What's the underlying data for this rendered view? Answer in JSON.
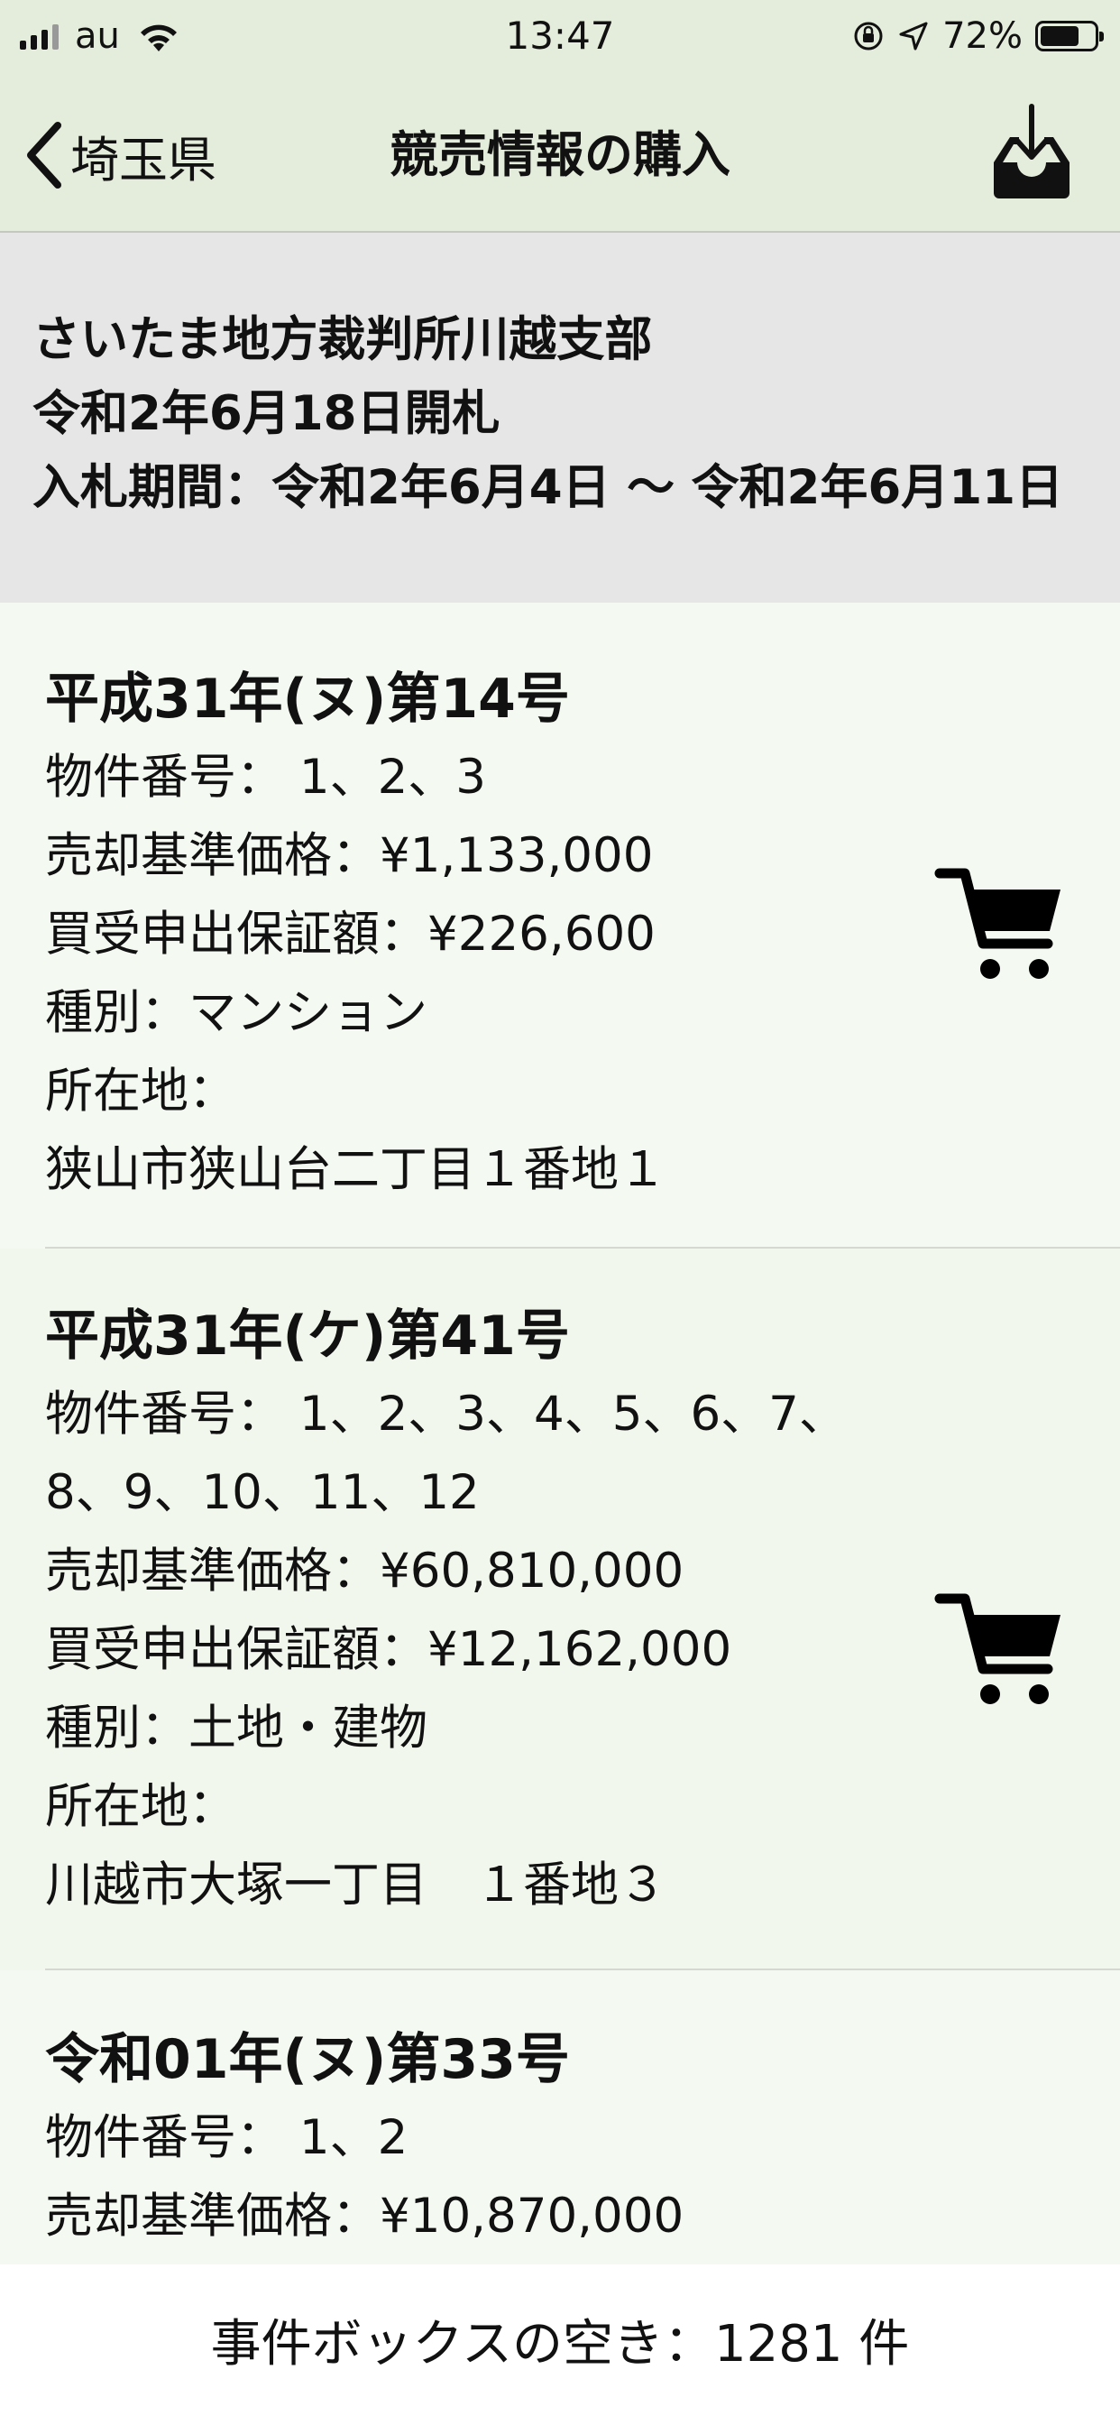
{
  "status_bar": {
    "carrier": "au",
    "time": "13:47",
    "battery_percent": "72%",
    "battery_level": 0.72
  },
  "nav": {
    "back_label": "埼玉県",
    "title": "競売情報の購入",
    "download_icon": "download-tray-icon"
  },
  "auction": {
    "court": "さいたま地方裁判所川越支部",
    "opening": "令和2年6月18日開札",
    "period": "入札期間：令和2年6月4日 〜 令和2年6月11日"
  },
  "cases": [
    {
      "title": "平成31年(ヌ)第14号",
      "property_numbers": "物件番号： 1、2、3",
      "property_numbers_cont": "",
      "base_price": "売却基準価格：¥1,133,000",
      "deposit": "買受申出保証額：¥226,600",
      "type": "種別：マンション",
      "location_label": "所在地：",
      "location": "狭山市狭山台二丁目１番地１"
    },
    {
      "title": "平成31年(ケ)第41号",
      "property_numbers": "物件番号： 1、2、3、4、5、6、7、",
      "property_numbers_cont": "8、9、10、11、12",
      "base_price": "売却基準価格：¥60,810,000",
      "deposit": "買受申出保証額：¥12,162,000",
      "type": "種別：土地・建物",
      "location_label": "所在地：",
      "location": "川越市大塚一丁目　１番地３"
    },
    {
      "title": "令和01年(ヌ)第33号",
      "property_numbers": "物件番号： 1、2",
      "base_price": "売却基準価格：¥10,870,000"
    }
  ],
  "footer": {
    "box_free": "事件ボックスの空き：1281 件"
  },
  "colors": {
    "bar_background": "#e4ecdb",
    "header_background": "#e6e6e6",
    "row_background": "#f4faf2",
    "row_alt_background": "#f1f7ec",
    "text": "#111111"
  }
}
